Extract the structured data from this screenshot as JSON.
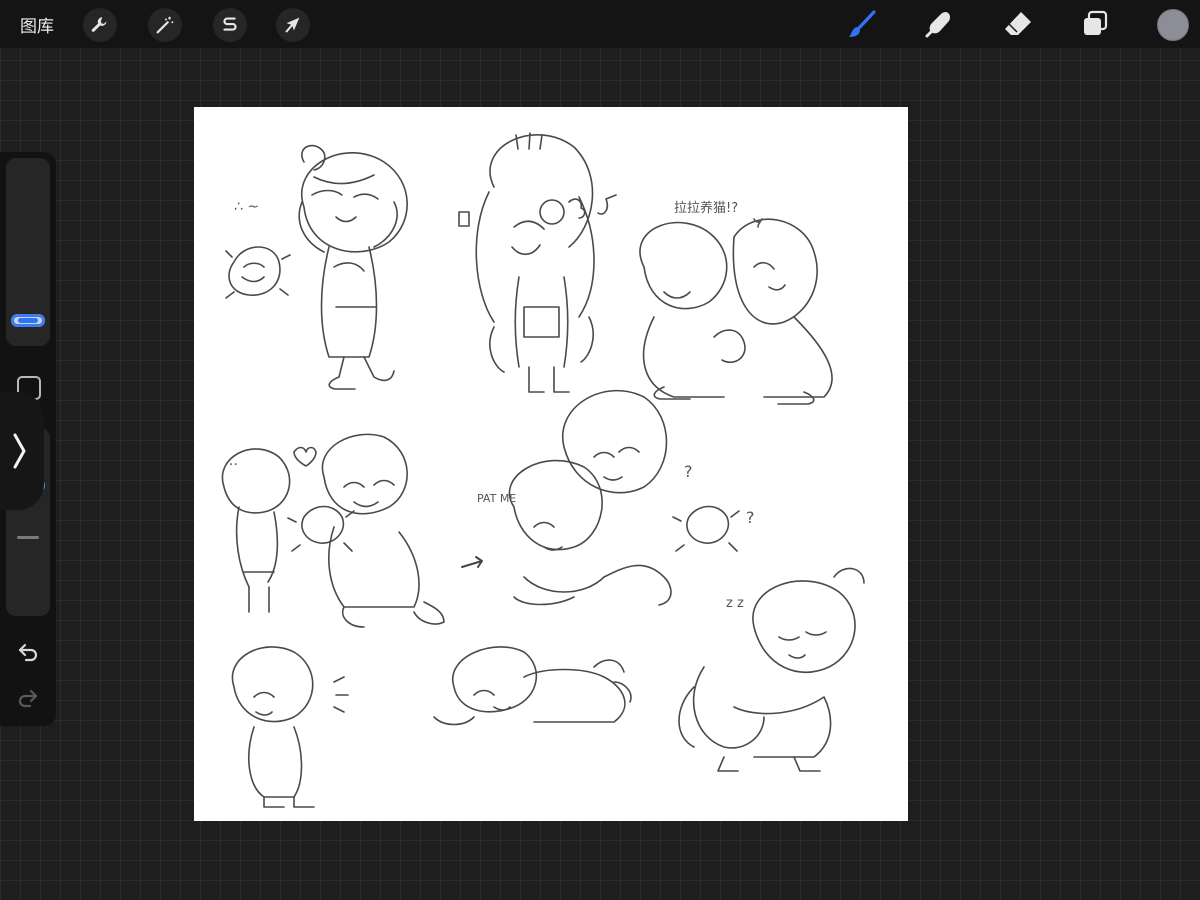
{
  "topbar": {
    "gallery_label": "图库",
    "actions_icon": "wrench-icon",
    "adjustments_icon": "magic-wand-icon",
    "selection_icon": "selection-s-icon",
    "transform_icon": "arrow-cursor-icon",
    "brush_icon": "brush-icon",
    "smudge_icon": "smudge-finger-icon",
    "eraser_icon": "eraser-icon",
    "layers_icon": "layers-icon",
    "accent_color": "#2f74f5",
    "current_color": "#8d8d99"
  },
  "canvas": {
    "annotations": {
      "hmm": "∴ ~",
      "dialogue": "拉拉养猫!?",
      "pat_me": "PAT ME",
      "dots": "…",
      "zz": "z z",
      "question_1": "?",
      "question_2": "?"
    }
  }
}
